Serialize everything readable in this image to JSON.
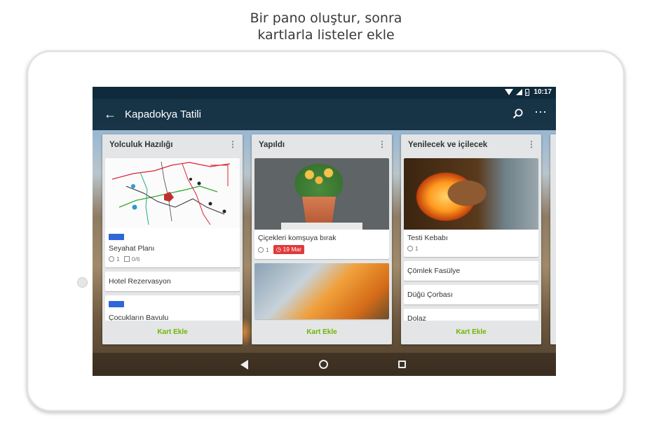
{
  "headline": {
    "line1": "Bir pano oluştur, sonra",
    "line2": "kartlarla listeler ekle"
  },
  "status_bar": {
    "time": "10:17",
    "icons": [
      "wifi-icon",
      "signal-icon",
      "battery-icon"
    ]
  },
  "app_bar": {
    "title": "Kapadokya Tatili",
    "icons": [
      "back-arrow-icon",
      "search-icon",
      "more-vert-icon"
    ]
  },
  "lists": [
    {
      "title": "Yolculuk Hazılığı",
      "cards": [
        {
          "title": "Seyahat Planı",
          "attachments": "1",
          "checklist": "0/6",
          "label_color": "#2f66d8"
        },
        {
          "title": "Hotel Rezervasyon"
        },
        {
          "title": "Çocukların Bavulu",
          "label_color": "#2f66d8"
        }
      ],
      "add_card": "Kart Ekle"
    },
    {
      "title": "Yapıldı",
      "cards": [
        {
          "title": "Çiçekleri komşuya bırak",
          "attachments": "1",
          "due": "19 Mar"
        }
      ],
      "add_card": "Kart Ekle"
    },
    {
      "title": "Yenilecek ve içilecek",
      "cards": [
        {
          "title": "Testi Kebabı",
          "attachments": "1"
        },
        {
          "title": "Çömlek Fasülye"
        },
        {
          "title": "Düğü Çorbası"
        },
        {
          "title": "Dolaz"
        }
      ],
      "add_card": "Kart Ekle"
    }
  ],
  "colors": {
    "app_bar": "#0e2a3b",
    "add_card_text": "#70b500",
    "label_blue": "#2f66d8",
    "due_badge": "#e03a3a"
  }
}
